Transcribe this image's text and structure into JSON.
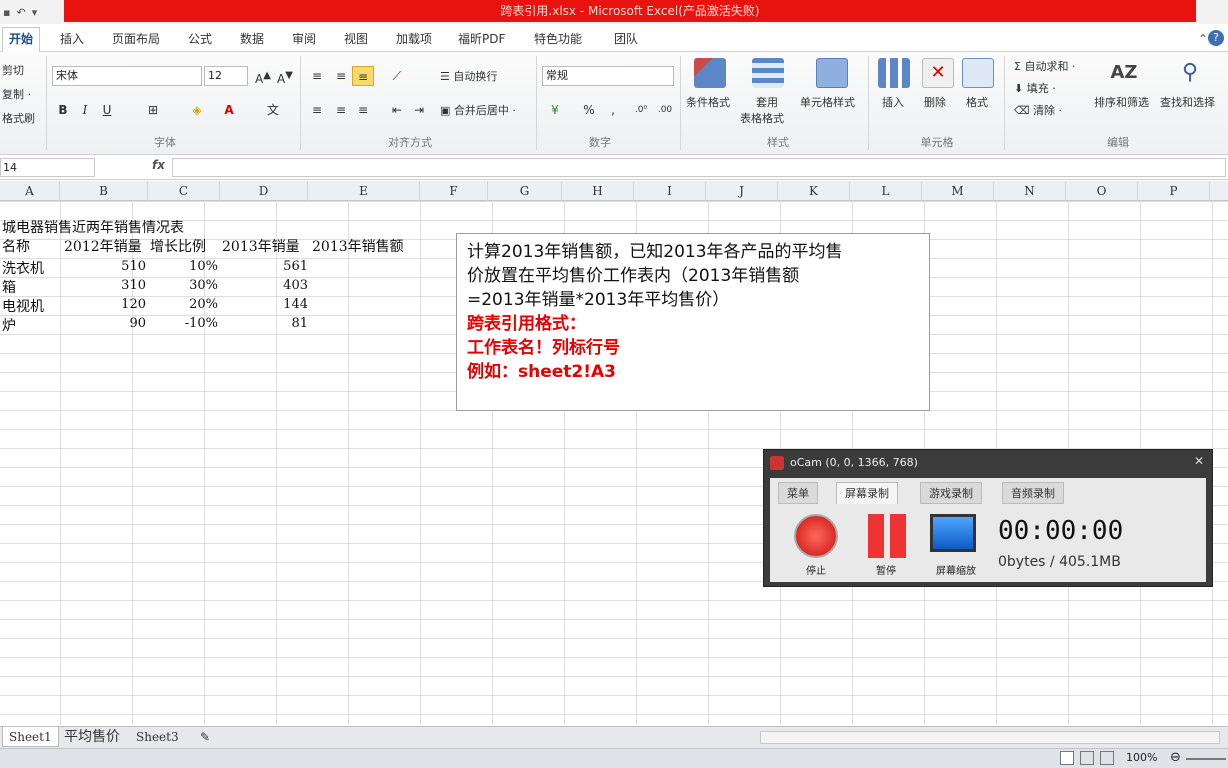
{
  "window": {
    "title": "跨表引用.xlsx - Microsoft Excel(产品激活失败)"
  },
  "tabs": [
    "开始",
    "插入",
    "页面布局",
    "公式",
    "数据",
    "审阅",
    "视图",
    "加载项",
    "福昕PDF",
    "特色功能",
    "团队"
  ],
  "clipboard": {
    "cut": "剪切",
    "copy": "复制 ·",
    "format_painter": "格式刷"
  },
  "font": {
    "name": "宋体",
    "size": "12",
    "group_label": "字体"
  },
  "alignment": {
    "wrap": "自动换行",
    "merge": "合并后居中 ·",
    "group_label": "对齐方式"
  },
  "number": {
    "format": "常规",
    "group_label": "数字"
  },
  "styles": {
    "cond_format": "条件格式",
    "table_format_1": "套用",
    "table_format_2": "表格格式",
    "cell_style": "单元格样式",
    "group_label": "样式"
  },
  "cells": {
    "insert": "插入",
    "delete": "删除",
    "format": "格式",
    "group_label": "单元格"
  },
  "editing": {
    "autosum": "自动求和 ·",
    "fill": "填充 ·",
    "clear": "清除 ·",
    "sort": "排序和筛选",
    "find": "查找和选择",
    "group_label": "编辑"
  },
  "formula_bar": {
    "name_box": "14",
    "fx": "fx"
  },
  "columns": [
    "A",
    "B",
    "C",
    "D",
    "E",
    "F",
    "G",
    "H",
    "I",
    "J",
    "K",
    "L",
    "M",
    "N",
    "O",
    "P"
  ],
  "sheet": {
    "title": "城电器销售近两年销售情况表",
    "headers": [
      "名称",
      "2012年销量",
      "增长比例",
      "2013年销量",
      "2013年销售额"
    ],
    "rows": [
      [
        "洗衣机",
        "510",
        "10%",
        "561"
      ],
      [
        "箱",
        "310",
        "30%",
        "403"
      ],
      [
        "电视机",
        "120",
        "20%",
        "144"
      ],
      [
        "炉",
        "90",
        "-10%",
        "81"
      ]
    ]
  },
  "note": {
    "line1": "计算2013年销售额，已知2013年各产品的平均售",
    "line2": "价放置在平均售价工作表内（2013年销售额",
    "line3": "=2013年销量*2013年平均售价）",
    "red1": "跨表引用格式：",
    "red2": "工作表名！列标行号",
    "red3": "例如：sheet2!A3"
  },
  "ocam": {
    "title": "oCam (0, 0, 1366, 768)",
    "tabs": [
      "菜单",
      "屏幕录制",
      "游戏录制",
      "音频录制"
    ],
    "timer": "00:00:00",
    "size": "0bytes / 405.1MB",
    "buttons": [
      "停止",
      "暂停",
      "屏幕缩放"
    ]
  },
  "sheet_tabs": [
    "Sheet1",
    "平均售价",
    "Sheet3"
  ],
  "status": {
    "zoom": "100%"
  }
}
